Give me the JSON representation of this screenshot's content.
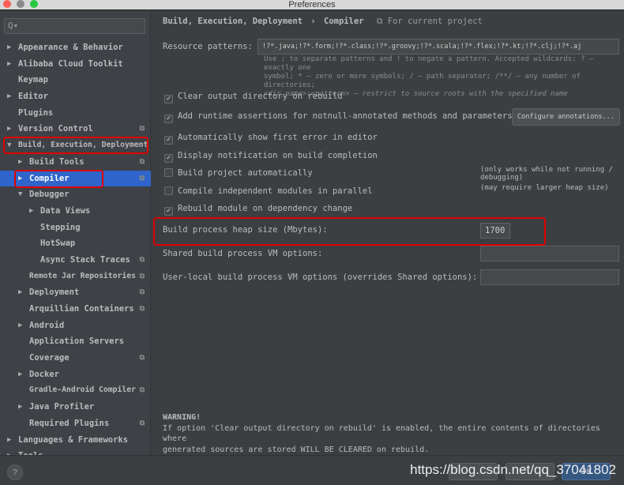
{
  "window": {
    "title": "Preferences",
    "lights": [
      "#fe5f57",
      "#8a8a8a",
      "#28c840"
    ]
  },
  "sidebar": {
    "search_placeholder": "Q▾",
    "items": [
      {
        "label": "Appearance & Behavior",
        "level": 0,
        "arrow": "right",
        "copy": false
      },
      {
        "label": "Alibaba Cloud Toolkit",
        "level": 0,
        "arrow": "right",
        "copy": false
      },
      {
        "label": "Keymap",
        "level": 0,
        "arrow": "",
        "copy": false
      },
      {
        "label": "Editor",
        "level": 0,
        "arrow": "right",
        "copy": false
      },
      {
        "label": "Plugins",
        "level": 0,
        "arrow": "",
        "copy": false
      },
      {
        "label": "Version Control",
        "level": 0,
        "arrow": "right",
        "copy": true
      },
      {
        "label": "Build, Execution, Deployment",
        "level": 0,
        "arrow": "down",
        "copy": false,
        "highlight": true
      },
      {
        "label": "Build Tools",
        "level": 1,
        "arrow": "right",
        "copy": true
      },
      {
        "label": "Compiler",
        "level": 1,
        "arrow": "right",
        "copy": true,
        "selected": true,
        "highlight": true
      },
      {
        "label": "Debugger",
        "level": 1,
        "arrow": "down",
        "copy": false
      },
      {
        "label": "Data Views",
        "level": 2,
        "arrow": "right",
        "copy": false
      },
      {
        "label": "Stepping",
        "level": 2,
        "arrow": "",
        "copy": false
      },
      {
        "label": "HotSwap",
        "level": 2,
        "arrow": "",
        "copy": false
      },
      {
        "label": "Async Stack Traces",
        "level": 2,
        "arrow": "",
        "copy": true
      },
      {
        "label": "Remote Jar Repositories",
        "level": 1,
        "arrow": "",
        "copy": true
      },
      {
        "label": "Deployment",
        "level": 1,
        "arrow": "right",
        "copy": true
      },
      {
        "label": "Arquillian Containers",
        "level": 1,
        "arrow": "",
        "copy": true
      },
      {
        "label": "Android",
        "level": 1,
        "arrow": "right",
        "copy": false
      },
      {
        "label": "Application Servers",
        "level": 1,
        "arrow": "",
        "copy": false
      },
      {
        "label": "Coverage",
        "level": 1,
        "arrow": "",
        "copy": true
      },
      {
        "label": "Docker",
        "level": 1,
        "arrow": "right",
        "copy": false
      },
      {
        "label": "Gradle-Android Compiler",
        "level": 1,
        "arrow": "",
        "copy": true
      },
      {
        "label": "Java Profiler",
        "level": 1,
        "arrow": "right",
        "copy": false
      },
      {
        "label": "Required Plugins",
        "level": 1,
        "arrow": "",
        "copy": true
      },
      {
        "label": "Languages & Frameworks",
        "level": 0,
        "arrow": "right",
        "copy": false
      },
      {
        "label": "Tools",
        "level": 0,
        "arrow": "right",
        "copy": false
      }
    ]
  },
  "main": {
    "breadcrumb": {
      "parent": "Build, Execution, Deployment",
      "sep": "›",
      "current": "Compiler",
      "scope": "⧉ For current project"
    },
    "resource_patterns": {
      "label": "Resource patterns:",
      "value": "!?*.java;!?*.form;!?*.class;!?*.groovy;!?*.scala;!?*.flex;!?*.kt;!?*.clj;!?*.aj"
    },
    "hint": [
      "Use ; to separate patterns and ! to negate a pattern. Accepted wildcards: ? — exactly one",
      "symbol; * — zero or more symbols; / — path separator; /**/ — any number of directories;",
      "<dir_name>:<pattern> — restrict to source roots with the specified name"
    ],
    "checkboxes": [
      {
        "label": "Clear output directory on rebuild",
        "checked": true
      },
      {
        "label": "Add runtime assertions for notnull-annotated methods and parameters",
        "checked": true
      },
      {
        "label": "Automatically show first error in editor",
        "checked": true
      },
      {
        "label": "Display notification on build completion",
        "checked": true
      },
      {
        "label": "Build project automatically",
        "checked": false,
        "note": "(only works while not running / debugging)"
      },
      {
        "label": "Compile independent modules in parallel",
        "checked": false,
        "note": "(may require larger heap size)"
      },
      {
        "label": "Rebuild module on dependency change",
        "checked": true
      }
    ],
    "configure_annotations": "Configure annotations...",
    "heap": {
      "label": "Build process heap size (Mbytes):",
      "value": "1700"
    },
    "shared_vm": {
      "label": "Shared build process VM options:",
      "value": ""
    },
    "user_vm": {
      "label": "User-local build process VM options (overrides Shared options):",
      "value": ""
    },
    "warning": [
      "WARNING!",
      "If option 'Clear output directory on rebuild' is enabled, the entire contents of directories where",
      "generated sources are stored WILL BE CLEARED on rebuild."
    ]
  },
  "footer": {
    "help": "?",
    "ok": "OK",
    "watermark": "https://blog.csdn.net/qq_37041802"
  }
}
